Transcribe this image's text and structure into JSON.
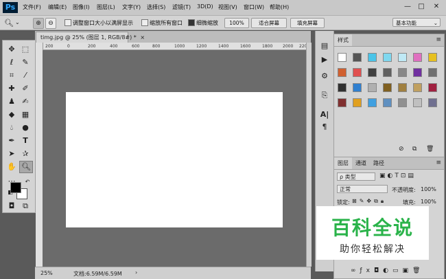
{
  "app": {
    "logo": "Ps"
  },
  "menu": [
    "文件(F)",
    "编辑(E)",
    "图像(I)",
    "图层(L)",
    "文字(Y)",
    "选择(S)",
    "滤镜(T)",
    "3D(D)",
    "视图(V)",
    "窗口(W)",
    "帮助(H)"
  ],
  "window_controls": {
    "minimize": "—",
    "restore": "□",
    "close": "✕"
  },
  "options": {
    "resize_windows": "调整窗口大小以满屏显示",
    "zoom_all": "缩放所有窗口",
    "scrubby_zoom": "细微缩放",
    "zoom_level": "100%",
    "fit_screen": "适合屏幕",
    "fill_screen": "填充屏幕",
    "workspace": "基本功能",
    "scrubby_checked": true
  },
  "document": {
    "tab_title": "timg.jpg @ 25% (图层 1, RGB/8#) *",
    "close": "×",
    "ruler_ticks": [
      "200",
      "0",
      "200",
      "400",
      "600",
      "800",
      "1000",
      "1200",
      "1400",
      "1600",
      "1800",
      "2000",
      "2200"
    ],
    "status_zoom": "25%",
    "status_doc": "文档:6.59M/6.59M"
  },
  "colors": {
    "foreground": "#000000",
    "background": "#ffffff",
    "accent": "#2ab34a"
  },
  "styles_panel": {
    "tab": "样式",
    "menu_icon": "≡",
    "swatches": [
      [
        "#ffffff",
        "#555555",
        "#4ac4e8",
        "#7fd8ef",
        "#bfe9f5",
        "#e070c0",
        "#e6c020"
      ],
      [
        "#d06030",
        "#e05050",
        "#404040",
        "#606060",
        "#888888",
        "#7030a0",
        "#707070"
      ],
      [
        "#303030",
        "#3080d0",
        "#b0b0b0",
        "#806020",
        "#a08040",
        "#c0a060",
        "#a02040"
      ],
      [
        "#803030",
        "#e0a020",
        "#40a0e0",
        "#6090c0",
        "#909090",
        "#c0c0c0",
        "#707090"
      ]
    ]
  },
  "layers_panel": {
    "tabs": [
      "图层",
      "通道",
      "路径"
    ],
    "filter_label": "ρ 类型",
    "blend_mode": "正常",
    "opacity_label": "不透明度:",
    "opacity_value": "100%",
    "lock_label": "锁定:",
    "fill_label": "填充:",
    "fill_value": "100%"
  },
  "watermark": {
    "title": "百科全说",
    "subtitle": "助你轻松解决"
  }
}
